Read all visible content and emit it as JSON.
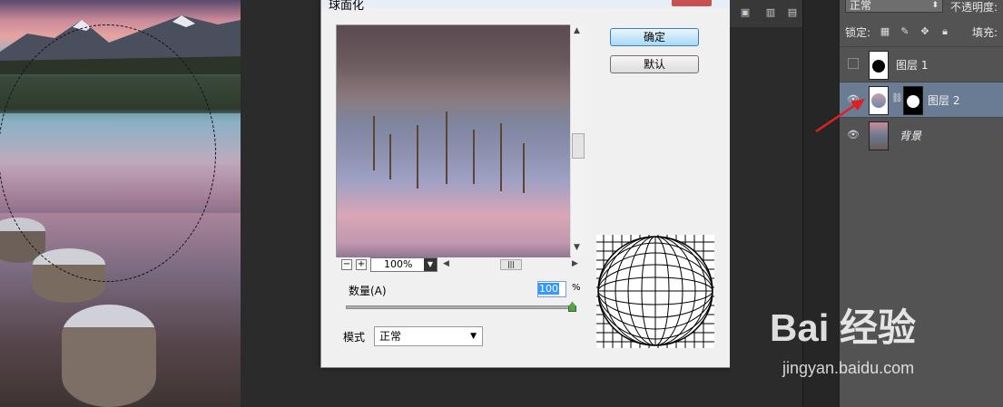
{
  "dialog": {
    "title": "球面化",
    "ok_label": "确定",
    "default_label": "默认",
    "zoom_minus": "−",
    "zoom_plus": "+",
    "zoom_value": "100%",
    "amount_label": "数量(A)",
    "amount_value": "100",
    "amount_unit": "%",
    "amount_fraction": 1.0,
    "mode_label": "模式",
    "mode_value": "正常"
  },
  "layers_panel": {
    "blend_mode": "正常",
    "opacity_label": "不透明度:",
    "lock_label": "锁定:",
    "fill_label": "填充:",
    "layers": [
      {
        "name": "图层 1",
        "visible": false,
        "selected": false
      },
      {
        "name": "图层 2",
        "visible": true,
        "selected": true
      },
      {
        "name": "背景",
        "visible": true,
        "selected": false
      }
    ]
  },
  "watermark": {
    "brand": "Bai  经验",
    "url": "jingyan.baidu.com"
  },
  "colors": {
    "selected_layer": "#6a7b94",
    "annotation_arrow": "#e02020",
    "primary_button": "#a7d9f5"
  }
}
